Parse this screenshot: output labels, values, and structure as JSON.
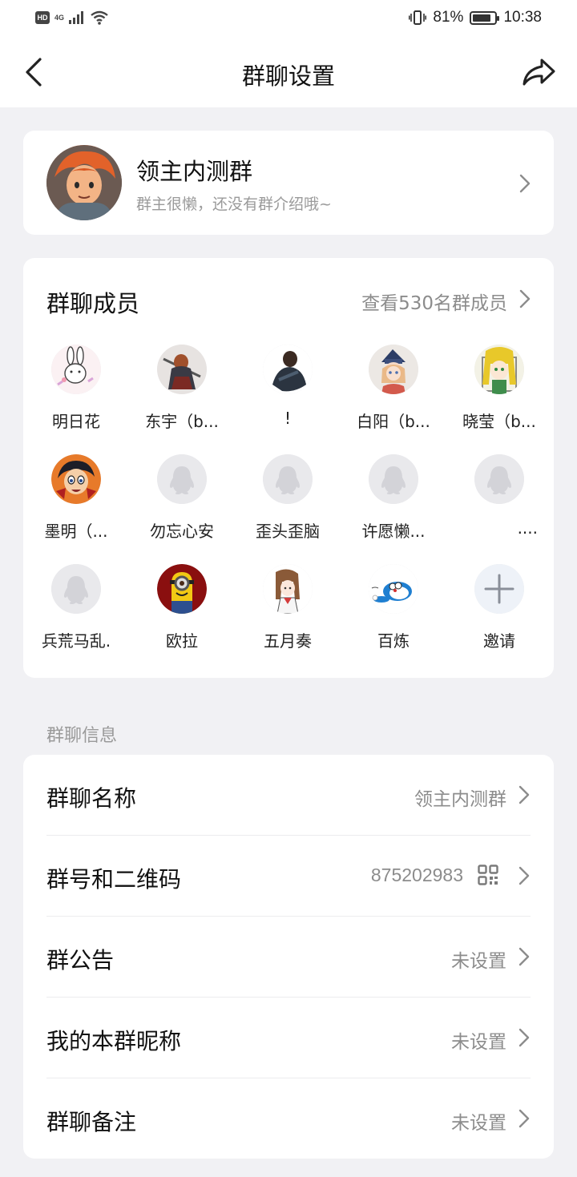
{
  "status_bar": {
    "hd": "HD",
    "signal": "4G",
    "battery_percent": "81%",
    "battery_level": 0.81,
    "time": "10:38"
  },
  "nav": {
    "title": "群聊设置"
  },
  "group": {
    "name": "领主内测群",
    "description": "群主很懒，还没有群介绍哦~"
  },
  "members": {
    "title": "群聊成员",
    "view_all": "查看530名群成员",
    "items": [
      {
        "name": "明日花",
        "avatar": "bunny-avatar"
      },
      {
        "name": "东宇（b...",
        "avatar": "warrior-avatar"
      },
      {
        "name": "!",
        "avatar": "dark-figure-avatar"
      },
      {
        "name": "白阳（b...",
        "avatar": "anime-girl-avatar"
      },
      {
        "name": "晓莹（b...",
        "avatar": "green-hair-avatar"
      },
      {
        "name": "墨明（...",
        "avatar": "detective-avatar"
      },
      {
        "name": "勿忘心安",
        "avatar": "default-avatar"
      },
      {
        "name": "歪头歪脑",
        "avatar": "default-avatar"
      },
      {
        "name": "许愿懒...",
        "avatar": "default-avatar"
      },
      {
        "name": "....",
        "avatar": "default-avatar"
      },
      {
        "name": "兵荒马乱.",
        "avatar": "default-avatar"
      },
      {
        "name": "欧拉",
        "avatar": "minion-avatar"
      },
      {
        "name": "五月奏",
        "avatar": "sketch-girl-avatar"
      },
      {
        "name": "百炼",
        "avatar": "doraemon-avatar"
      },
      {
        "name": "邀请",
        "avatar": "invite-plus"
      }
    ]
  },
  "info_section_label": "群聊信息",
  "info": {
    "name_label": "群聊名称",
    "name_value": "领主内测群",
    "number_label": "群号和二维码",
    "number_value": "875202983",
    "notice_label": "群公告",
    "notice_value": "未设置",
    "nickname_label": "我的本群昵称",
    "nickname_value": "未设置",
    "remark_label": "群聊备注",
    "remark_value": "未设置"
  }
}
